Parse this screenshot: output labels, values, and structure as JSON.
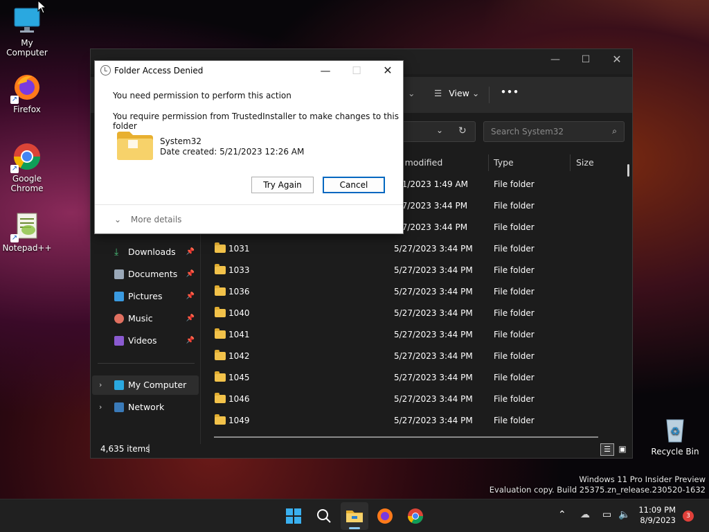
{
  "desktop": {
    "icons": [
      {
        "label": "My Computer"
      },
      {
        "label": "Firefox"
      },
      {
        "label": "Google Chrome"
      },
      {
        "label": "Notepad++"
      },
      {
        "label": "Recycle Bin"
      }
    ]
  },
  "explorer": {
    "toolbar": {
      "view_label": "View",
      "more_label": "•••"
    },
    "search": {
      "placeholder": "Search System32"
    },
    "nav": [
      {
        "label": "Downloads"
      },
      {
        "label": "Documents"
      },
      {
        "label": "Pictures"
      },
      {
        "label": "Music"
      },
      {
        "label": "Videos"
      },
      {
        "label": "My Computer"
      },
      {
        "label": "Network"
      }
    ],
    "columns": {
      "modified": "te modified",
      "type": "Type",
      "size": "Size"
    },
    "rows": [
      {
        "name": "",
        "modified": "/21/2023 1:49 AM",
        "type": "File folder"
      },
      {
        "name": "",
        "modified": "/27/2023 3:44 PM",
        "type": "File folder"
      },
      {
        "name": "",
        "modified": "/27/2023 3:44 PM",
        "type": "File folder"
      },
      {
        "name": "1031",
        "modified": "5/27/2023 3:44 PM",
        "type": "File folder"
      },
      {
        "name": "1033",
        "modified": "5/27/2023 3:44 PM",
        "type": "File folder"
      },
      {
        "name": "1036",
        "modified": "5/27/2023 3:44 PM",
        "type": "File folder"
      },
      {
        "name": "1040",
        "modified": "5/27/2023 3:44 PM",
        "type": "File folder"
      },
      {
        "name": "1041",
        "modified": "5/27/2023 3:44 PM",
        "type": "File folder"
      },
      {
        "name": "1042",
        "modified": "5/27/2023 3:44 PM",
        "type": "File folder"
      },
      {
        "name": "1045",
        "modified": "5/27/2023 3:44 PM",
        "type": "File folder"
      },
      {
        "name": "1046",
        "modified": "5/27/2023 3:44 PM",
        "type": "File folder"
      },
      {
        "name": "1049",
        "modified": "5/27/2023 3:44 PM",
        "type": "File folder"
      }
    ],
    "status": {
      "items_count": "4,635 items"
    }
  },
  "dialog": {
    "title": "Folder Access Denied",
    "message1": "You need permission to perform this action",
    "message2": "You require permission from TrustedInstaller to make changes to this folder",
    "folder_name": "System32",
    "date_created": "Date created: 5/21/2023 12:26 AM",
    "try_again_label": "Try Again",
    "cancel_label": "Cancel",
    "more_details_label": "More details"
  },
  "taskbar": {
    "time": "11:09 PM",
    "date": "8/9/2023",
    "notification_count": "3"
  },
  "watermark": {
    "line1": "Windows 11 Pro Insider Preview",
    "line2": "Evaluation copy. Build 25375.zn_release.230520-1632"
  },
  "colors": {
    "accent": "#0067c0",
    "folder": "#f2c24a"
  }
}
